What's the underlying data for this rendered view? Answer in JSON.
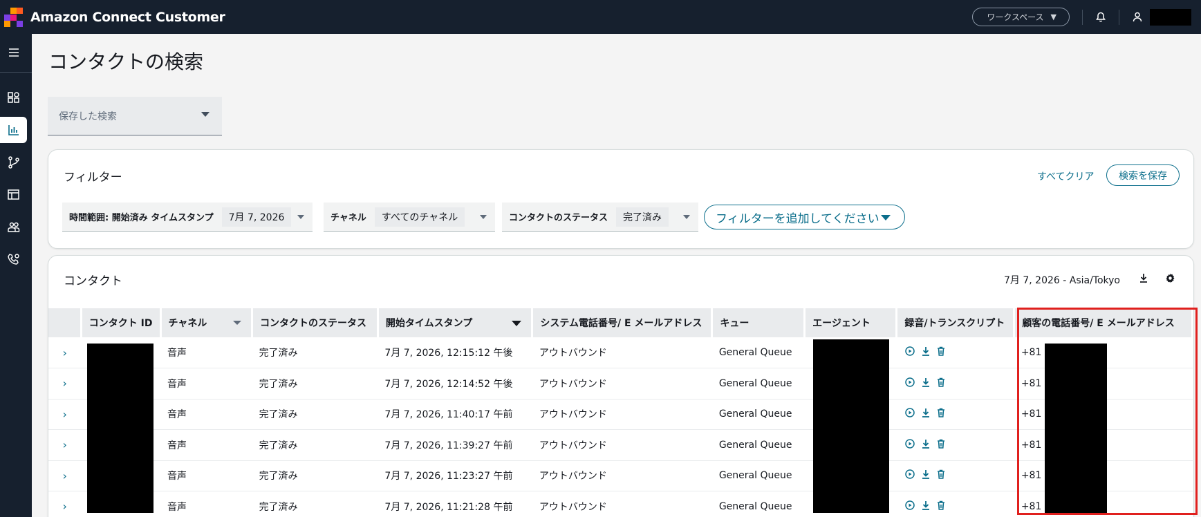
{
  "app": {
    "brand": "Amazon Connect Customer",
    "workspace_label": "ワークスペース",
    "colors": {
      "navy": "#16202e",
      "accent": "#0b6e8b",
      "highlight": "#e0201e"
    }
  },
  "topbar_icons": [
    "bell-icon",
    "user-icon"
  ],
  "sidebar": {
    "items": [
      {
        "name": "menu-icon"
      },
      {
        "name": "dashboard-icon"
      },
      {
        "name": "analytics-icon",
        "active": true
      },
      {
        "name": "routing-icon"
      },
      {
        "name": "table-icon"
      },
      {
        "name": "users-icon"
      },
      {
        "name": "phone-settings-icon"
      }
    ]
  },
  "page": {
    "title": "コンタクトの検索",
    "saved_search_placeholder": "保存した検索"
  },
  "filters": {
    "title": "フィルター",
    "clear_all": "すべてクリア",
    "save_search": "検索を保存",
    "chips": [
      {
        "label": "時間範囲: 開始済み タイムスタンプ",
        "value": "7月 7, 2026"
      },
      {
        "label": "チャネル",
        "value": "すべてのチャネル"
      },
      {
        "label": "コンタクトのステータス",
        "value": "完了済み"
      }
    ],
    "add_filter": "フィルターを追加してください"
  },
  "contacts": {
    "title": "コンタクト",
    "date_tz": "7月 7, 2026 - Asia/Tokyo",
    "columns": [
      "コンタクト ID",
      "チャネル",
      "コンタクトのステータス",
      "開始タイムスタンプ",
      "システム電話番号/ E メールアドレス",
      "キュー",
      "エージェント",
      "録音/トランスクリプト",
      "顧客の電話番号/ E メールアドレス"
    ],
    "rows": [
      {
        "channel": "音声",
        "status": "完了済み",
        "start": "7月 7, 2026, 12:15:12 午後",
        "system": "アウトバウンド",
        "queue": "General Queue",
        "customer": "+81"
      },
      {
        "channel": "音声",
        "status": "完了済み",
        "start": "7月 7, 2026, 12:14:52 午後",
        "system": "アウトバウンド",
        "queue": "General Queue",
        "customer": "+81"
      },
      {
        "channel": "音声",
        "status": "完了済み",
        "start": "7月 7, 2026, 11:40:17 午前",
        "system": "アウトバウンド",
        "queue": "General Queue",
        "customer": "+81"
      },
      {
        "channel": "音声",
        "status": "完了済み",
        "start": "7月 7, 2026, 11:39:27 午前",
        "system": "アウトバウンド",
        "queue": "General Queue",
        "customer": "+81"
      },
      {
        "channel": "音声",
        "status": "完了済み",
        "start": "7月 7, 2026, 11:23:27 午前",
        "system": "アウトバウンド",
        "queue": "General Queue",
        "customer": "+81"
      },
      {
        "channel": "音声",
        "status": "完了済み",
        "start": "7月 7, 2026, 11:21:28 午前",
        "system": "アウトバウンド",
        "queue": "General Queue",
        "customer": "+81"
      }
    ]
  }
}
